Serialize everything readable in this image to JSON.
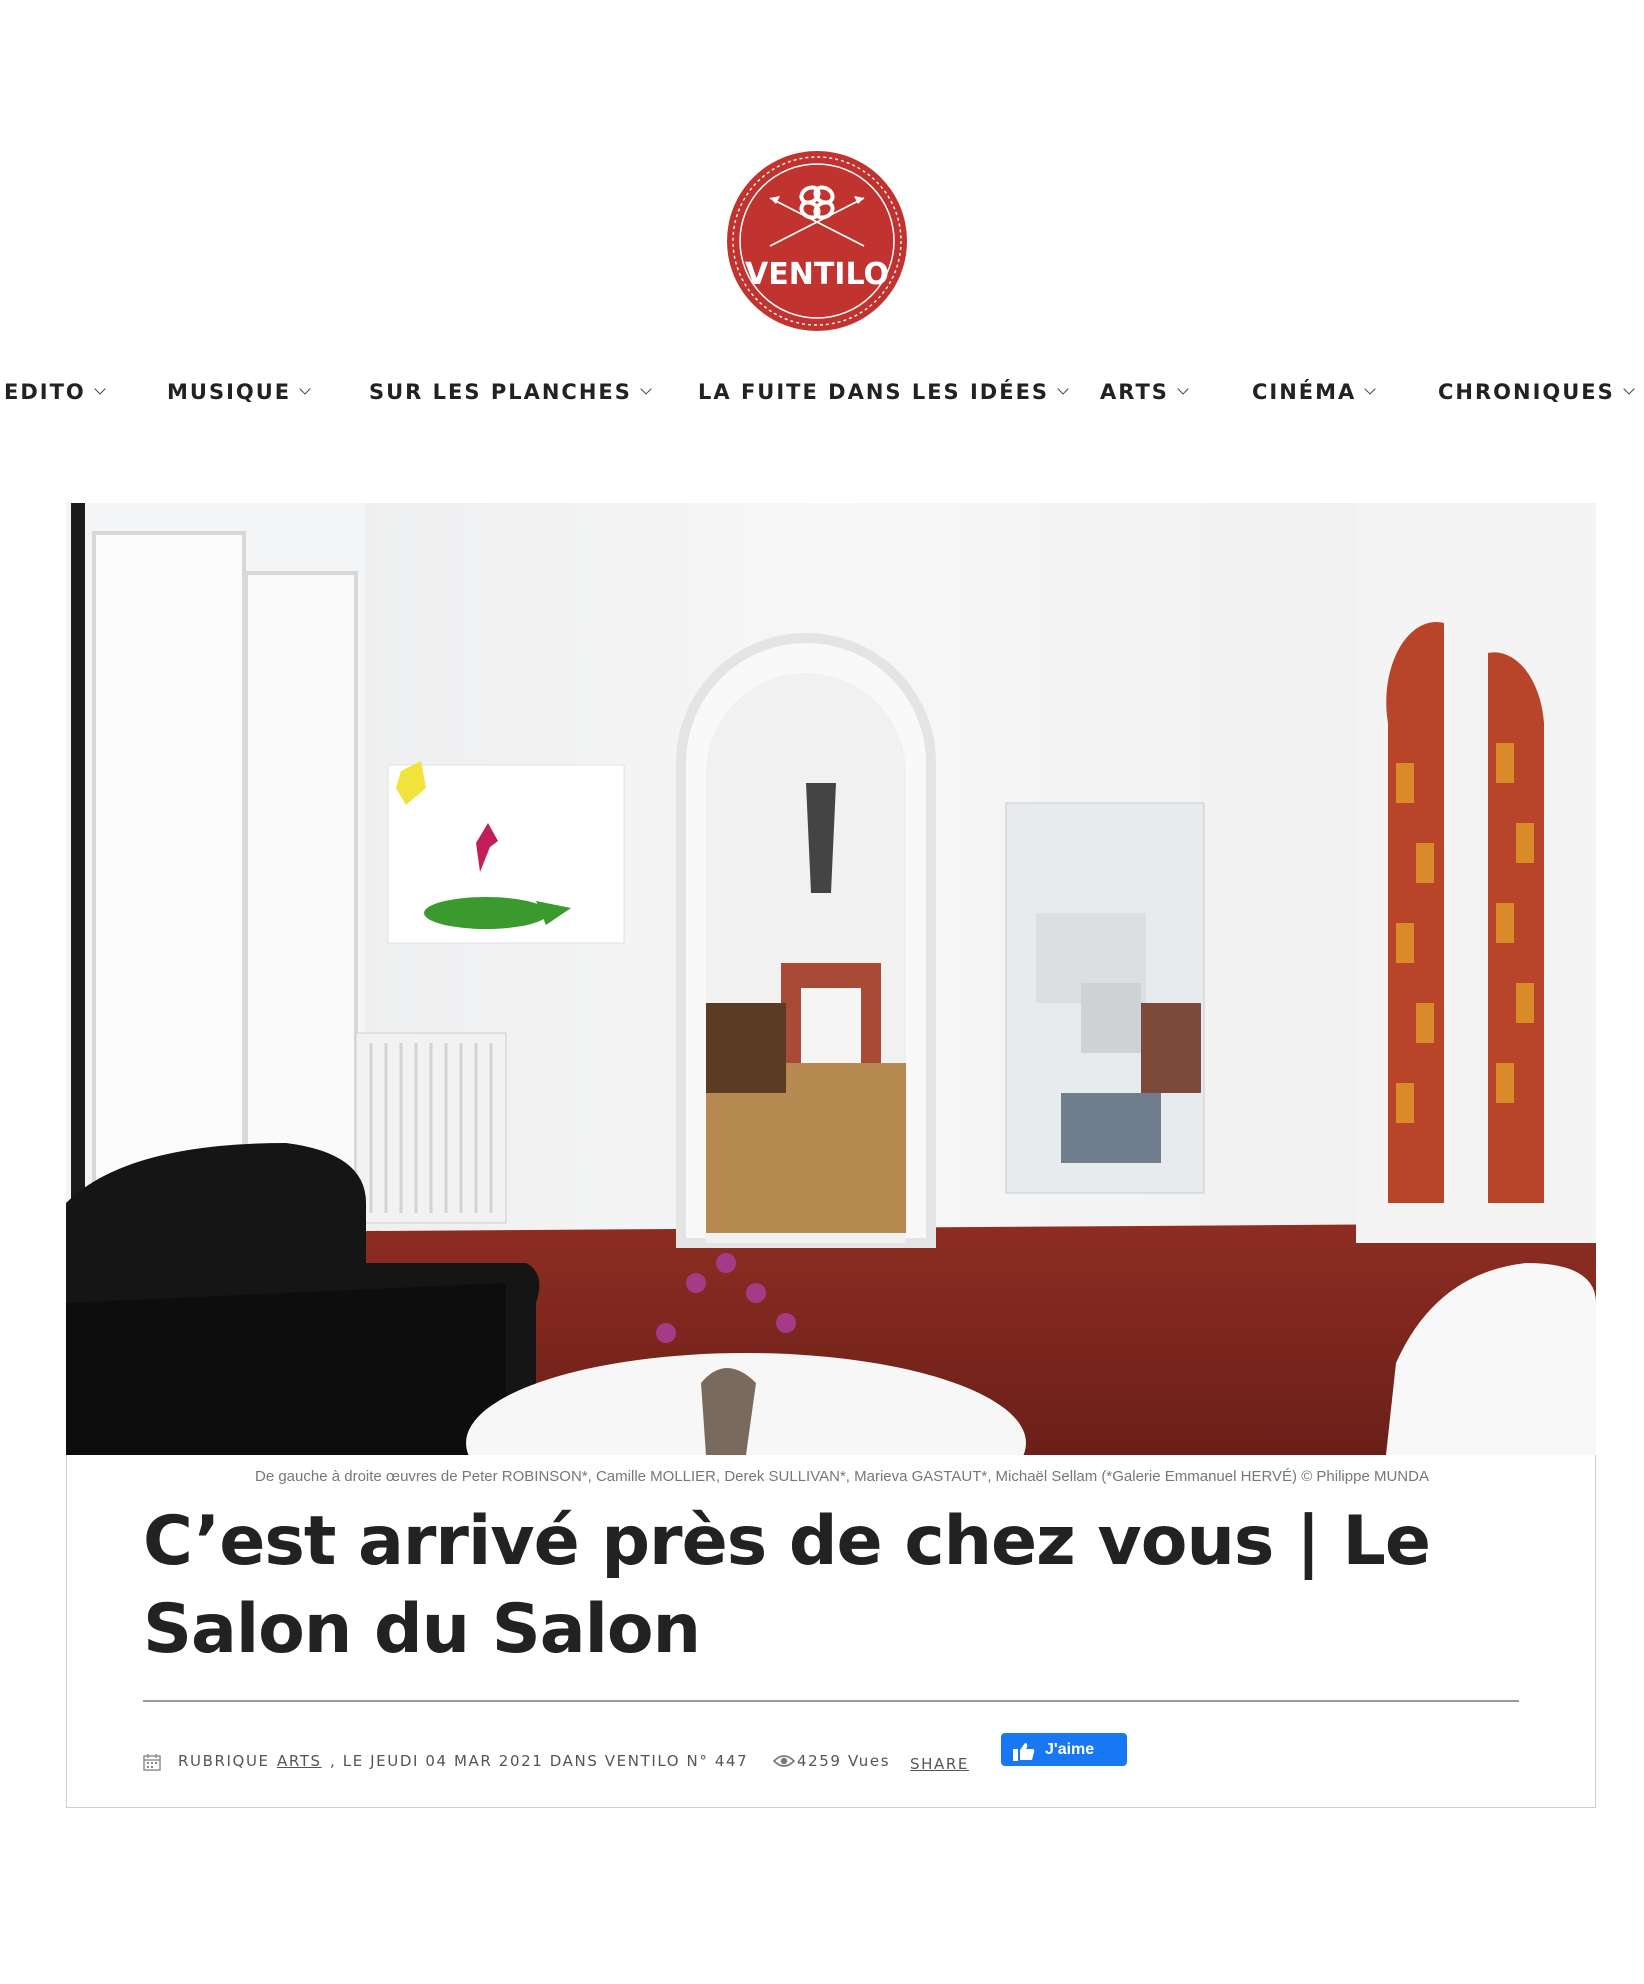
{
  "logo": {
    "text": "VENTILO",
    "color": "#c0332f"
  },
  "nav": {
    "items": [
      {
        "label": "EDITO"
      },
      {
        "label": "MUSIQUE"
      },
      {
        "label": "SUR LES PLANCHES"
      },
      {
        "label": "LA FUITE DANS LES IDÉES"
      },
      {
        "label": "ARTS"
      },
      {
        "label": "CINÉMA"
      },
      {
        "label": "CHRONIQUES"
      }
    ]
  },
  "article": {
    "caption": "De gauche à droite œuvres de Peter ROBINSON*, Camille MOLLIER, Derek SULLIVAN*, Marieva GASTAUT*, Michaël Sellam (*Galerie Emmanuel HERVÉ) © Philippe MUNDA",
    "title": "C’est arrivé près de chez vous | Le Salon du Salon",
    "meta": {
      "rubrique_prefix": "RUBRIQUE",
      "rubrique_link": "ARTS",
      "date_text": ", LE JEUDI 04 MAR 2021 DANS VENTILO N° 447",
      "views": "4259 Vues",
      "share_label": "SHARE",
      "like_label": "J'aime"
    }
  },
  "colors": {
    "brand_red": "#c0332f",
    "facebook_blue": "#1877f2"
  }
}
